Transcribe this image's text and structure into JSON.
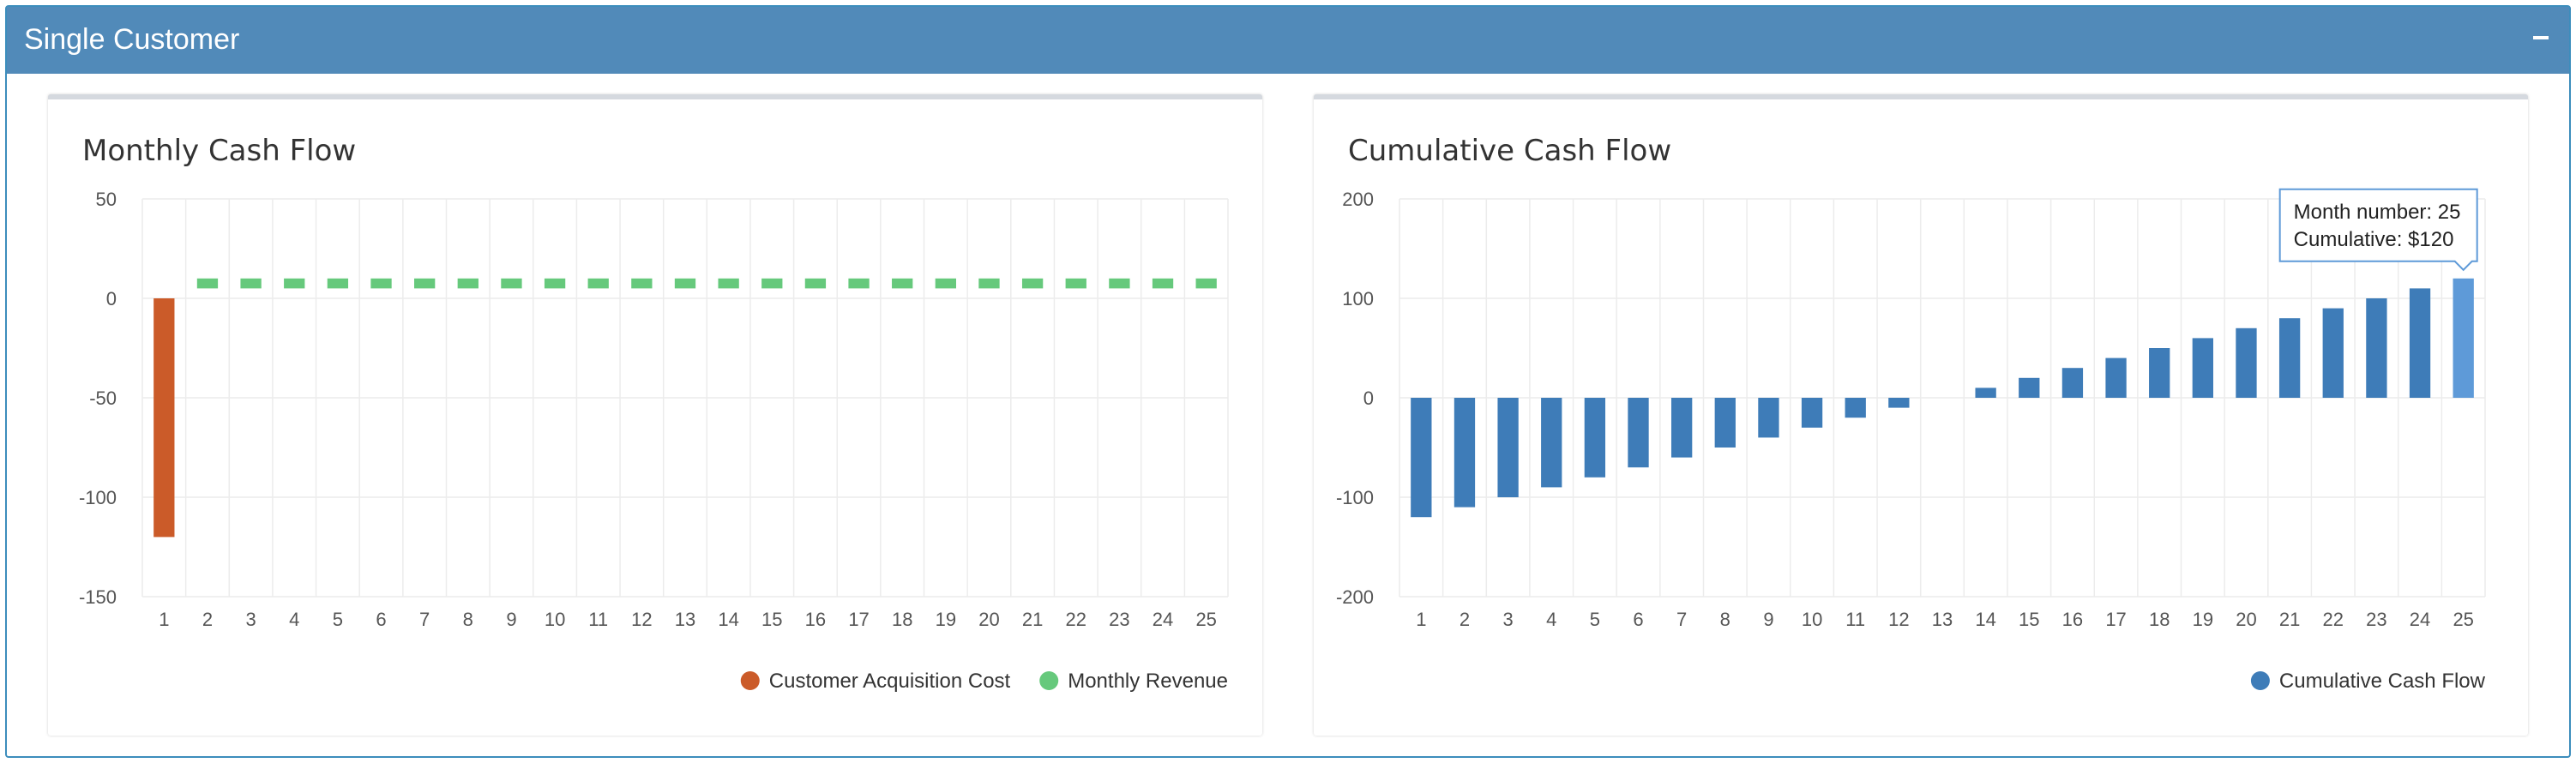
{
  "header": {
    "title": "Single Customer",
    "collapse_label": "−"
  },
  "colors": {
    "header_bg": "#518ab9",
    "cac": "#cb5b29",
    "revenue": "#66c97c",
    "cumulative": "#3e7cb8",
    "cumulative_highlight": "#5e9ad8"
  },
  "chart_data": [
    {
      "type": "bar",
      "title": "Monthly Cash Flow",
      "categories": [
        "1",
        "2",
        "3",
        "4",
        "5",
        "6",
        "7",
        "8",
        "9",
        "10",
        "11",
        "12",
        "13",
        "14",
        "15",
        "16",
        "17",
        "18",
        "19",
        "20",
        "21",
        "22",
        "23",
        "24",
        "25"
      ],
      "ylim": [
        -150,
        50
      ],
      "yticks": [
        50,
        0,
        -50,
        -100,
        -150
      ],
      "grid": true,
      "legend_placement": "bottom-right",
      "series": [
        {
          "name": "Customer Acquisition Cost",
          "color": "#cb5b29",
          "values": [
            -120,
            null,
            null,
            null,
            null,
            null,
            null,
            null,
            null,
            null,
            null,
            null,
            null,
            null,
            null,
            null,
            null,
            null,
            null,
            null,
            null,
            null,
            null,
            null,
            null
          ]
        },
        {
          "name": "Monthly Revenue",
          "color": "#66c97c",
          "from": 5,
          "to": 10,
          "values": [
            null,
            5,
            5,
            5,
            5,
            5,
            5,
            5,
            5,
            5,
            5,
            5,
            5,
            5,
            5,
            5,
            5,
            5,
            5,
            5,
            5,
            5,
            5,
            5,
            5
          ]
        }
      ]
    },
    {
      "type": "bar",
      "title": "Cumulative Cash Flow",
      "categories": [
        "1",
        "2",
        "3",
        "4",
        "5",
        "6",
        "7",
        "8",
        "9",
        "10",
        "11",
        "12",
        "13",
        "14",
        "15",
        "16",
        "17",
        "18",
        "19",
        "20",
        "21",
        "22",
        "23",
        "24",
        "25"
      ],
      "ylim": [
        -200,
        200
      ],
      "yticks": [
        200,
        100,
        0,
        -100,
        -200
      ],
      "grid": true,
      "legend_placement": "bottom-right",
      "series": [
        {
          "name": "Cumulative Cash Flow",
          "color": "#3e7cb8",
          "values": [
            -120,
            -110,
            -100,
            -90,
            -80,
            -70,
            -60,
            -50,
            -40,
            -30,
            -20,
            -10,
            0,
            10,
            20,
            30,
            40,
            50,
            60,
            70,
            80,
            90,
            100,
            110,
            120
          ]
        }
      ],
      "tooltip": {
        "index": 24,
        "line1": "Month number: 25",
        "line2": "Cumulative: $120"
      }
    }
  ]
}
